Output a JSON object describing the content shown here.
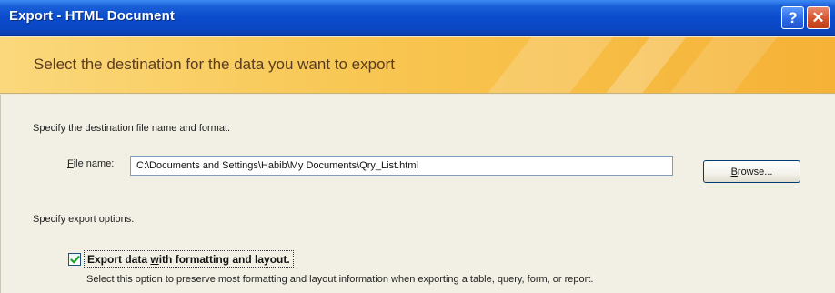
{
  "window": {
    "title": "Export - HTML Document",
    "help_glyph": "?",
    "close_glyph": "✕"
  },
  "banner": {
    "heading": "Select the destination for the data you want to export"
  },
  "destination": {
    "instruction": "Specify the destination file name and format.",
    "file_label_mnemonic": "F",
    "file_label_rest": "ile name:",
    "file_value": "C:\\Documents and Settings\\Habib\\My Documents\\Qry_List.html",
    "browse_mnemonic": "B",
    "browse_rest": "rowse..."
  },
  "options": {
    "instruction": "Specify export options.",
    "export_formatting": {
      "checked": true,
      "label_pre": "Export data ",
      "label_mnemonic": "w",
      "label_post": "ith formatting and layout.",
      "description": "Select this option to preserve most formatting and layout information when exporting a table, query, form, or report."
    }
  },
  "colors": {
    "titlebar": "#0a4bcc",
    "banner": "#f8c651",
    "dialog_bg": "#ece9d8",
    "checkmark": "#21a121"
  }
}
